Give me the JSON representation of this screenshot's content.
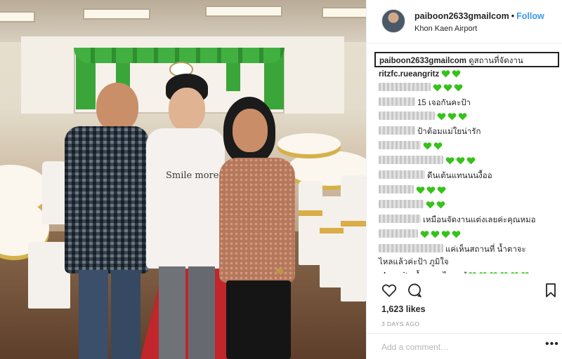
{
  "photo": {
    "shirt_text": "Smile more"
  },
  "header": {
    "username": "paiboon2633gmailcom",
    "separator": "•",
    "follow_label": "Follow",
    "location": "Khon Kaen Airport"
  },
  "caption": {
    "username": "paiboon2633gmailcom",
    "text": "ดูสถานที่จัดงาน"
  },
  "comments": [
    {
      "username": "ritzfc.rueangritz",
      "text": ""
    },
    {
      "username": "",
      "text": ""
    },
    {
      "username": "",
      "text": "15 เจอกันคะป้า"
    },
    {
      "username": "",
      "text": ""
    },
    {
      "username": "",
      "text": "ป้าต้อมแม่ใยน่ารัก"
    },
    {
      "username": "",
      "text": ""
    },
    {
      "username": "",
      "text": ""
    },
    {
      "username": "",
      "text": "ดีนเต้นแทนนนงื้ออ"
    },
    {
      "username": "",
      "text": ""
    },
    {
      "username": "",
      "text": ""
    },
    {
      "username": "",
      "text": "เหมือนจัดงานแต่งเลยค่ะคุณหมอ"
    },
    {
      "username": "",
      "text": ""
    },
    {
      "username": "",
      "text": "แค่เห็นสถานที่ น้ำตาจะ"
    },
    {
      "username": "",
      "text": "ไหลแล้วค่ะป้า ภูมิใจ"
    },
    {
      "username": "ploy_ritz",
      "text": "น้ำตาจะไหลแล้"
    }
  ],
  "icons": {
    "heart_emoji": "green-heart-icon",
    "like": "heart-outline-icon",
    "comment": "speech-bubble-icon",
    "save": "bookmark-icon"
  },
  "colors": {
    "follow": "#3897f0",
    "green_heart": "#36c21a",
    "caption_border": "#222222"
  },
  "stats": {
    "likes": "1,623 likes",
    "timestamp": "3 DAYS AGO"
  },
  "add_comment": {
    "placeholder": "Add a comment…",
    "more_label": "•••"
  }
}
